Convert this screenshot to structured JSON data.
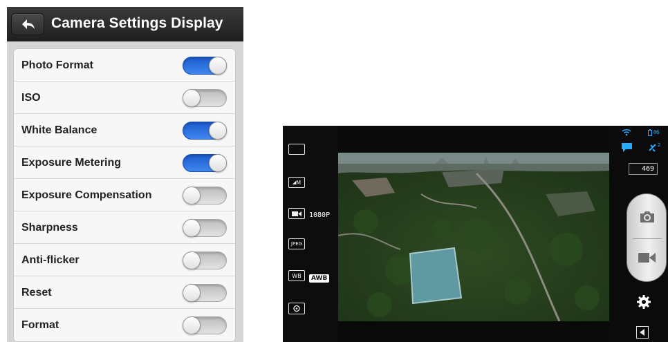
{
  "settings": {
    "title": "Camera Settings Display",
    "items": [
      {
        "label": "Photo Format",
        "enabled": true
      },
      {
        "label": "ISO",
        "enabled": false
      },
      {
        "label": "White Balance",
        "enabled": true
      },
      {
        "label": "Exposure Metering",
        "enabled": true
      },
      {
        "label": "Exposure Compensation",
        "enabled": false
      },
      {
        "label": "Sharpness",
        "enabled": false
      },
      {
        "label": "Anti-flicker",
        "enabled": false
      },
      {
        "label": "Reset",
        "enabled": false
      },
      {
        "label": "Format",
        "enabled": false
      }
    ]
  },
  "camera": {
    "left_bar": {
      "mode_label": "M",
      "resolution": "1080P",
      "format": "JPEG",
      "wb_label": "WB",
      "wb_value": "AWB"
    },
    "status": {
      "battery_value": "46",
      "signal_value": "2"
    },
    "remaining_count": "469"
  },
  "colors": {
    "toggle_on": "#2f74e0",
    "accent_status": "#29a8ff"
  }
}
